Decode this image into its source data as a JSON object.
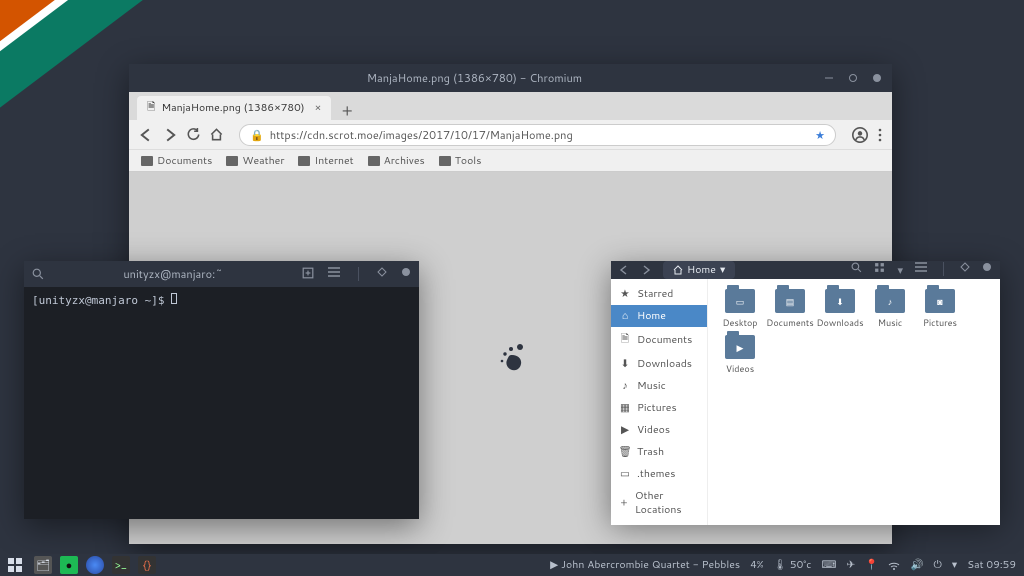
{
  "browser": {
    "window_title": "ManjaHome.png (1386×780) - Chromium",
    "tab_title": "ManjaHome.png (1386×780)",
    "url": "https://cdn.scrot.moe/images/2017/10/17/ManjaHome.png",
    "bookmarks": [
      "Documents",
      "Weather",
      "Internet",
      "Archives",
      "Tools"
    ]
  },
  "terminal": {
    "title": "unityzx@manjaro:~",
    "prompt": "[unityzx@manjaro ~]$"
  },
  "filemanager": {
    "path_label": "Home",
    "sidebar": [
      {
        "icon": "star",
        "label": "Starred"
      },
      {
        "icon": "home",
        "label": "Home",
        "active": true
      },
      {
        "icon": "doc",
        "label": "Documents"
      },
      {
        "icon": "download",
        "label": "Downloads"
      },
      {
        "icon": "music",
        "label": "Music"
      },
      {
        "icon": "pic",
        "label": "Pictures"
      },
      {
        "icon": "video",
        "label": "Videos"
      },
      {
        "icon": "trash",
        "label": "Trash"
      },
      {
        "icon": "folder",
        "label": ".themes"
      },
      {
        "icon": "plus",
        "label": "Other Locations"
      }
    ],
    "files": [
      {
        "name": "Desktop",
        "glyph": "▭"
      },
      {
        "name": "Documents",
        "glyph": "▤"
      },
      {
        "name": "Downloads",
        "glyph": "⬇"
      },
      {
        "name": "Music",
        "glyph": "♪"
      },
      {
        "name": "Pictures",
        "glyph": "◙"
      },
      {
        "name": "Videos",
        "glyph": "▶"
      }
    ]
  },
  "panel": {
    "now_playing": "John Abercrombie Quartet - Pebbles",
    "cpu": "4%",
    "temp": "50°c",
    "clock": "Sat 09:59"
  }
}
